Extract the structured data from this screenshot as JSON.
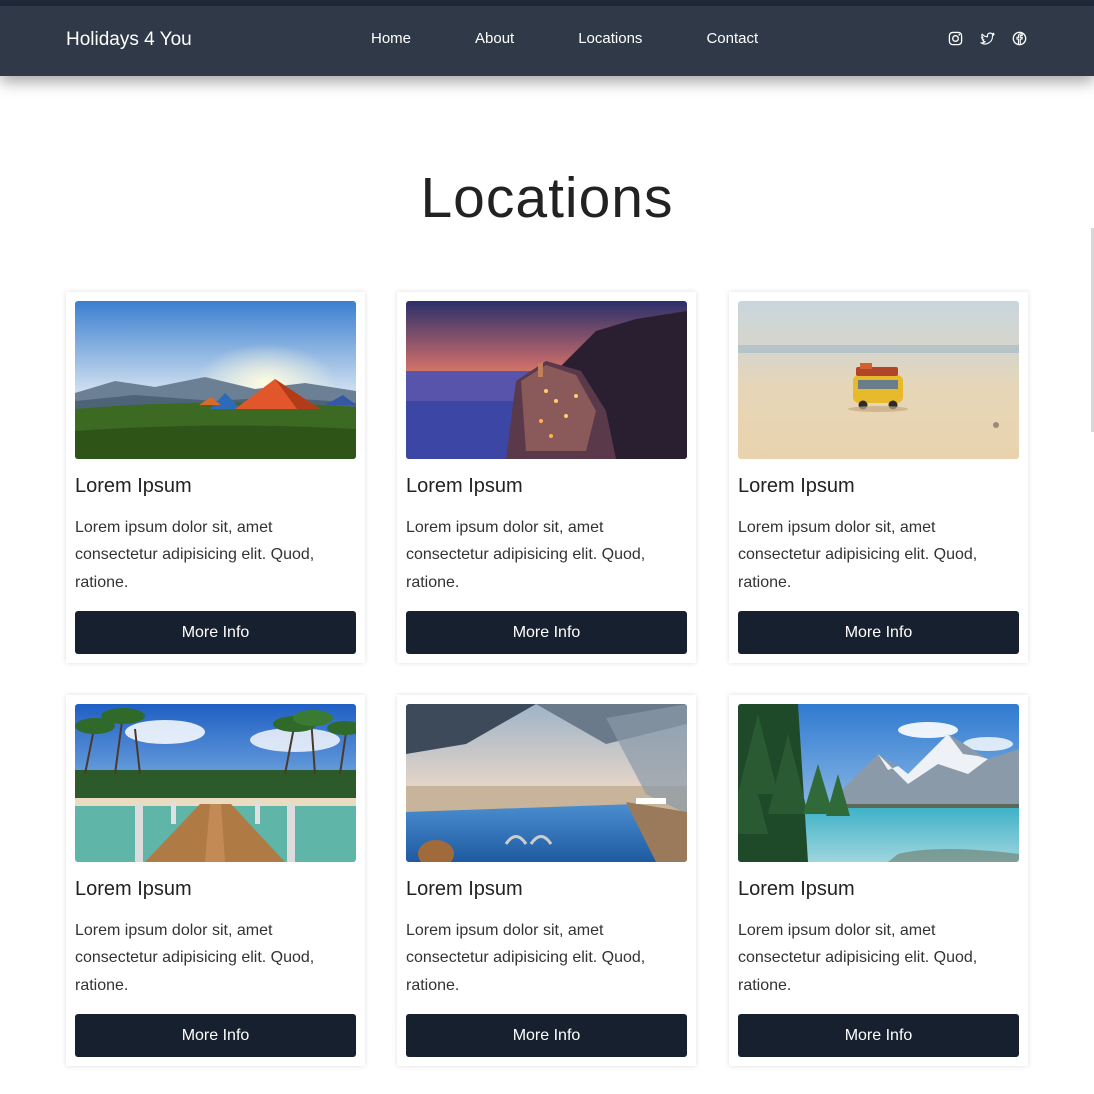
{
  "header": {
    "brand": "Holidays 4 You",
    "nav": [
      {
        "label": "Home"
      },
      {
        "label": "About"
      },
      {
        "label": "Locations"
      },
      {
        "label": "Contact"
      }
    ],
    "socials": [
      "instagram-icon",
      "twitter-icon",
      "facebook-icon"
    ]
  },
  "main": {
    "title": "Locations",
    "cards": [
      {
        "image": "camping-tents-photo",
        "title": "Lorem Ipsum",
        "text": "Lorem ipsum dolor sit, amet consectetur adipisicing elit. Quod, ratione.",
        "button": "More Info"
      },
      {
        "image": "coastal-village-sunset-photo",
        "title": "Lorem Ipsum",
        "text": "Lorem ipsum dolor sit, amet consectetur adipisicing elit. Quod, ratione.",
        "button": "More Info"
      },
      {
        "image": "toy-bus-beach-photo",
        "title": "Lorem Ipsum",
        "text": "Lorem ipsum dolor sit, amet consectetur adipisicing elit. Quod, ratione.",
        "button": "More Info"
      },
      {
        "image": "pier-palm-beach-photo",
        "title": "Lorem Ipsum",
        "text": "Lorem ipsum dolor sit, amet consectetur adipisicing elit. Quod, ratione.",
        "button": "More Info"
      },
      {
        "image": "infinity-pool-photo",
        "title": "Lorem Ipsum",
        "text": "Lorem ipsum dolor sit, amet consectetur adipisicing elit. Quod, ratione.",
        "button": "More Info"
      },
      {
        "image": "mountain-lake-photo",
        "title": "Lorem Ipsum",
        "text": "Lorem ipsum dolor sit, amet consectetur adipisicing elit. Quod, ratione.",
        "button": "More Info"
      }
    ]
  },
  "colors": {
    "navbar": "#2f3947",
    "button": "#17202e",
    "text": "#222222"
  }
}
